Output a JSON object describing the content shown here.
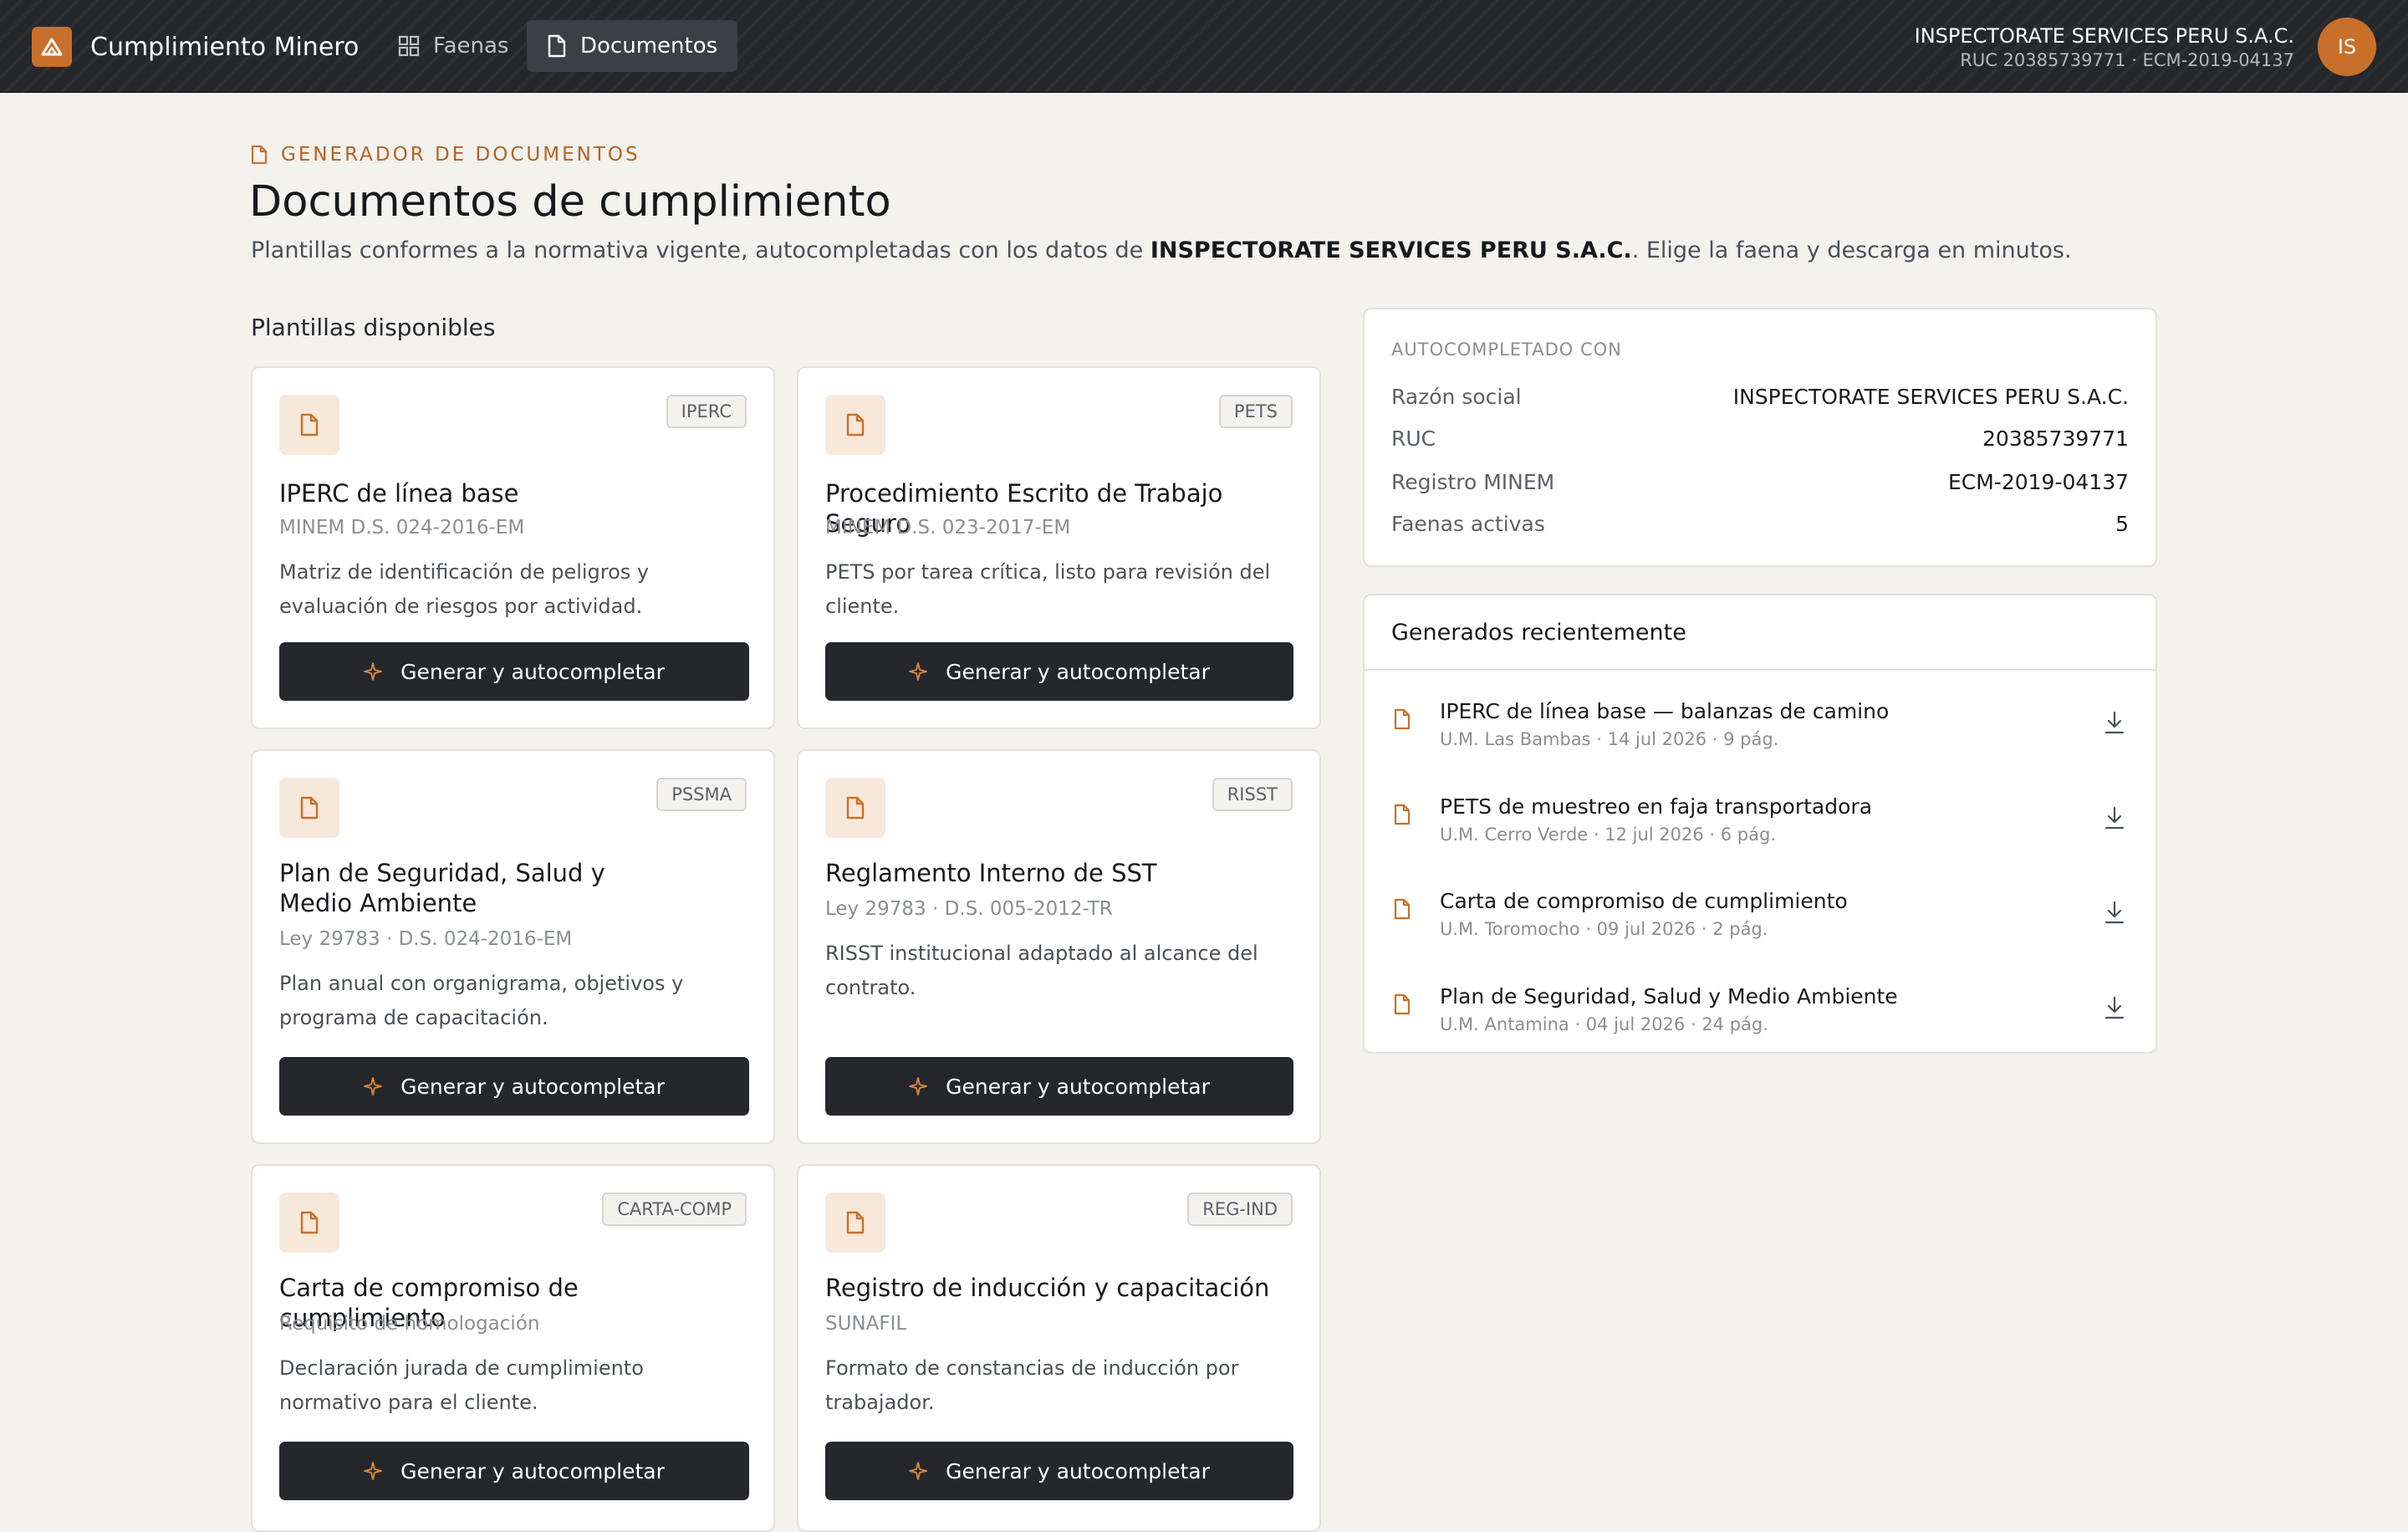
{
  "app": {
    "name": "Cumplimiento Minero",
    "nav": [
      {
        "label": "Faenas",
        "icon": "grid-icon"
      },
      {
        "label": "Documentos",
        "icon": "document-icon",
        "active": true
      }
    ],
    "company": {
      "name": "INSPECTORATE SERVICES PERU S.A.C.",
      "meta": "RUC 20385739771 · ECM-2019-04137",
      "initials": "IS"
    }
  },
  "page": {
    "eyebrow": "GENERADOR DE DOCUMENTOS",
    "title": "Documentos de cumplimiento",
    "subtitle_before": "Plantillas conformes a la normativa vigente, autocompletadas con los datos de ",
    "subtitle_company": "INSPECTORATE SERVICES PERU S.A.C.",
    "subtitle_after": ". Elige la faena y descarga en minutos.",
    "section_title": "Plantillas disponibles"
  },
  "templates": [
    {
      "tag": "IPERC",
      "title": "IPERC de línea base",
      "ref": "MINEM D.S. 024-2016-EM",
      "desc": "Matriz de identificación de peligros y evaluación de riesgos por actividad.",
      "button": "Generar y autocompletar"
    },
    {
      "tag": "PETS",
      "title": "Procedimiento Escrito de Trabajo Seguro",
      "ref": "MINEM D.S. 023-2017-EM",
      "desc": "PETS por tarea crítica, listo para revisión del cliente.",
      "button": "Generar y autocompletar"
    },
    {
      "tag": "PSSMA",
      "title": "Plan de Seguridad, Salud y Medio Ambiente",
      "ref": "Ley 29783 · D.S. 024-2016-EM",
      "desc": "Plan anual con organigrama, objetivos y programa de capacitación.",
      "button": "Generar y autocompletar"
    },
    {
      "tag": "RISST",
      "title": "Reglamento Interno de SST",
      "ref": "Ley 29783 · D.S. 005-2012-TR",
      "desc": "RISST institucional adaptado al alcance del contrato.",
      "button": "Generar y autocompletar"
    },
    {
      "tag": "CARTA-COMP",
      "title": "Carta de compromiso de cumplimiento",
      "ref": "Requisito de homologación",
      "desc": "Declaración jurada de cumplimiento normativo para el cliente.",
      "button": "Generar y autocompletar"
    },
    {
      "tag": "REG-IND",
      "title": "Registro de inducción y capacitación",
      "ref": "SUNAFIL",
      "desc": "Formato de constancias de inducción por trabajador.",
      "button": "Generar y autocompletar"
    }
  ],
  "autofill": {
    "label": "AUTOCOMPLETADO CON",
    "rows": [
      {
        "key": "Razón social",
        "value": "INSPECTORATE SERVICES PERU S.A.C."
      },
      {
        "key": "RUC",
        "value": "20385739771"
      },
      {
        "key": "Registro MINEM",
        "value": "ECM-2019-04137"
      },
      {
        "key": "Faenas activas",
        "value": "5"
      }
    ]
  },
  "recent": {
    "title": "Generados recientemente",
    "items": [
      {
        "title": "IPERC de línea base — balanzas de camino",
        "meta": "U.M. Las Bambas · 14 jul 2026 · 9 pág."
      },
      {
        "title": "PETS de muestreo en faja transportadora",
        "meta": "U.M. Cerro Verde · 12 jul 2026 · 6 pág."
      },
      {
        "title": "Carta de compromiso de cumplimiento",
        "meta": "U.M. Toromocho · 09 jul 2026 · 2 pág."
      },
      {
        "title": "Plan de Seguridad, Salud y Medio Ambiente",
        "meta": "U.M. Antamina · 04 jul 2026 · 24 pág."
      }
    ]
  },
  "colors": {
    "accent": "#c8702a",
    "topbar": "#25272b",
    "background": "#f3f2ef",
    "button": "#25272b"
  }
}
